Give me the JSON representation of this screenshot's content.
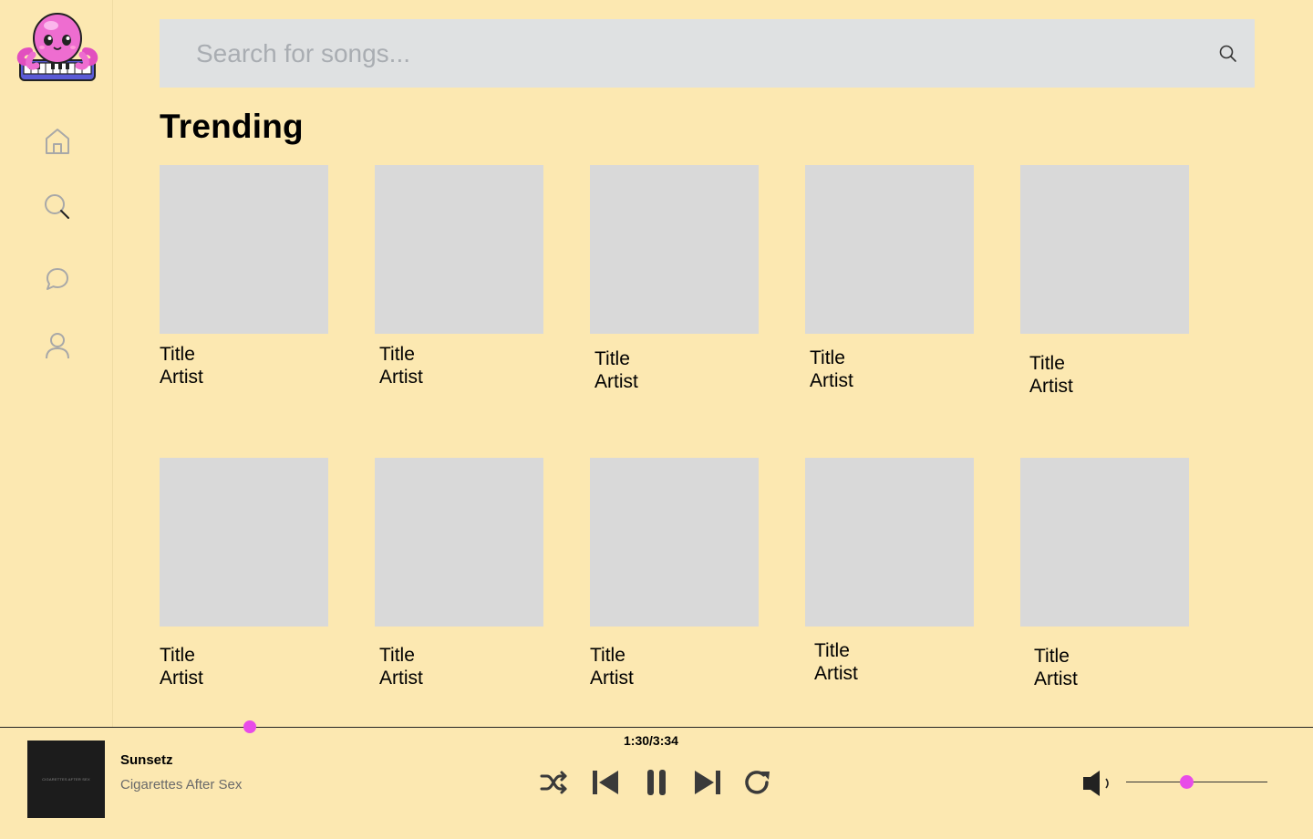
{
  "colors": {
    "background": "#fce8b1",
    "search_bg": "#dfe1e2",
    "cover_placeholder": "#d9d9d9",
    "accent": "#e84ce8",
    "icon_gray": "#a8a8a8",
    "control_dark": "#3a3a3a"
  },
  "sidebar": {
    "logo_icon": "octopus-piano-logo",
    "items": [
      {
        "name": "home",
        "icon": "home-icon"
      },
      {
        "name": "search",
        "icon": "search-icon"
      },
      {
        "name": "chat",
        "icon": "chat-bubble-icon"
      },
      {
        "name": "profile",
        "icon": "user-icon"
      }
    ]
  },
  "search": {
    "placeholder": "Search for songs...",
    "value": "",
    "icon": "search-icon"
  },
  "trending": {
    "heading": "Trending",
    "items": [
      {
        "title": "Title",
        "artist": "Artist"
      },
      {
        "title": "Title",
        "artist": "Artist"
      },
      {
        "title": "Title",
        "artist": "Artist"
      },
      {
        "title": "Title",
        "artist": "Artist"
      },
      {
        "title": "Title",
        "artist": "Artist"
      },
      {
        "title": "Title",
        "artist": "Artist"
      },
      {
        "title": "Title",
        "artist": "Artist"
      },
      {
        "title": "Title",
        "artist": "Artist"
      },
      {
        "title": "Title",
        "artist": "Artist"
      },
      {
        "title": "Title",
        "artist": "Artist"
      }
    ]
  },
  "player": {
    "album_art_text": "CIGARETTES AFTER SEX",
    "song_title": "Sunsetz",
    "song_artist": "Cigarettes After Sex",
    "time": "1:30/3:34",
    "progress_fraction": 0.19,
    "volume_fraction": 0.43,
    "controls": [
      "shuffle-icon",
      "previous-icon",
      "pause-icon",
      "next-icon",
      "repeat-icon"
    ],
    "volume_icon": "volume-icon"
  }
}
